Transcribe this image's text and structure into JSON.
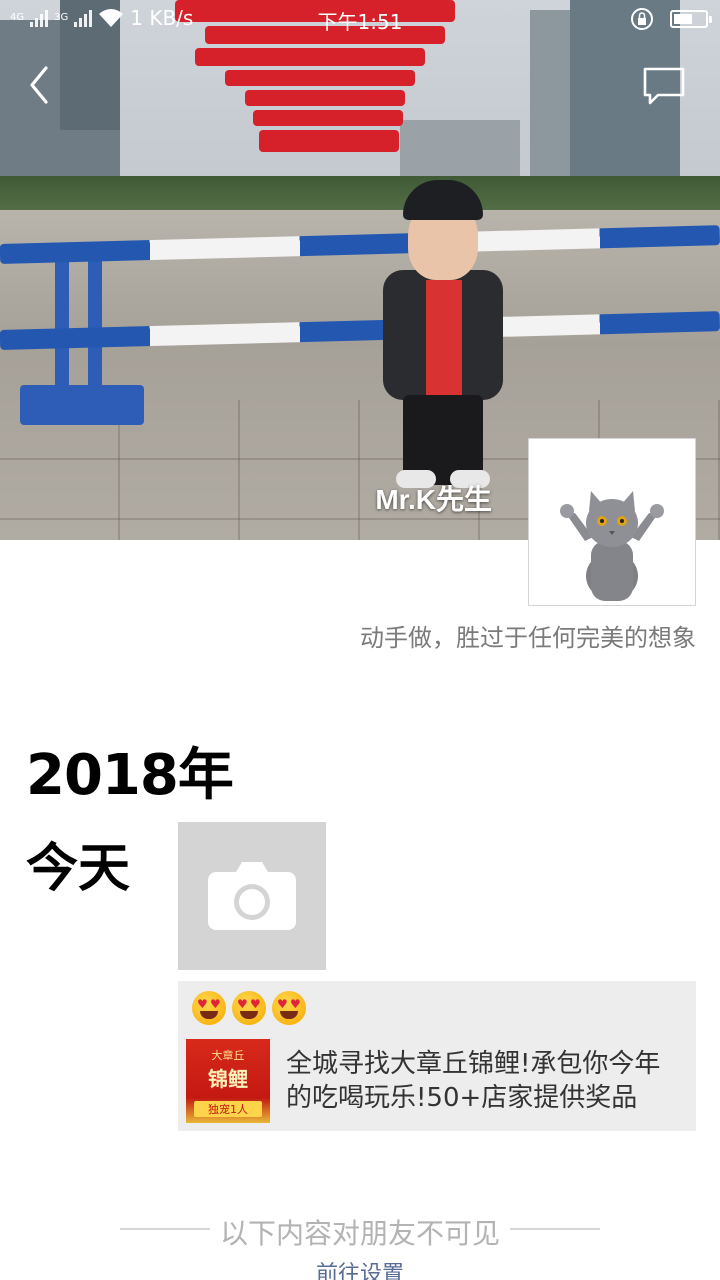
{
  "status_bar": {
    "network_1": "4G",
    "network_2": "3G",
    "speed": "1 KB/s",
    "time": "下午1:51",
    "battery_level": 0.6
  },
  "profile": {
    "name": "Mr.K先生",
    "signature": "动手做，胜过于任何完美的想象"
  },
  "timeline": {
    "year": "2018年",
    "day": "今天",
    "post": {
      "emojis": [
        "heart-eyes-emoji",
        "heart-eyes-emoji",
        "heart-eyes-emoji"
      ],
      "link_thumb_top": "大章丘",
      "link_thumb_title": "锦鲤",
      "link_thumb_badge": "独宠1人",
      "link_title": "全城寻找大章丘锦鲤!承包你今年的吃喝玩乐!50+店家提供奖品"
    }
  },
  "footer": {
    "invisible_notice": "以下内容对朋友不可见",
    "go_settings": "前往设置"
  },
  "colors": {
    "link_blue": "#576b95",
    "gray_text": "#7a7a7a",
    "card_bg": "#ededed"
  }
}
